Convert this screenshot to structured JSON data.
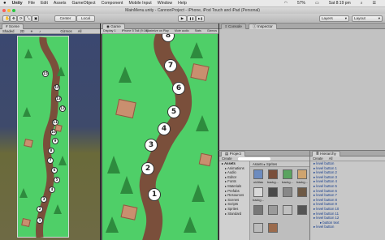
{
  "menubar": {
    "apple": "",
    "items": [
      "Unity",
      "File",
      "Edit",
      "Assets",
      "GameObject",
      "Component",
      "Mobile Input",
      "Window",
      "Help"
    ],
    "battery": "57%",
    "clock": "Sat 8:19 pm"
  },
  "window": {
    "title": "MainMenu.unity - CannonProject - iPhone, iPod Touch and iPad (Personal)"
  },
  "toolbar": {
    "tools": [
      "✋",
      "✥",
      "⟳",
      "⤡",
      "▣"
    ],
    "center": "Center",
    "local": "Local",
    "play": "▶",
    "pause": "❚❚",
    "step": "▶❚",
    "layers": "Layers",
    "layout": "Layout"
  },
  "scene": {
    "tab": "Scene",
    "shaded": "Shaded",
    "mode": "2D",
    "gizmos": "Gizmos",
    "search": "All",
    "path_numbers": [
      "15",
      "14",
      "13",
      "12",
      "11",
      "10",
      "9",
      "8",
      "7",
      "6",
      "5",
      "4",
      "3",
      "2",
      "1"
    ]
  },
  "game": {
    "tab": "Game",
    "display": "Display 1",
    "resolution": "iPhone 5 Tall (9:16)",
    "maximize": "Maximize on Play",
    "mute": "Mute audio",
    "stats": "Stats",
    "gizmos": "Gizmos",
    "path_numbers": [
      "8",
      "7",
      "6",
      "5",
      "4",
      "3",
      "2",
      "1"
    ]
  },
  "console": {
    "tab": "Console"
  },
  "inspector": {
    "tab": "Inspector"
  },
  "project": {
    "tab": "Project",
    "create": "Create",
    "breadcrumb": [
      "Assets",
      "Sprites"
    ],
    "tree": [
      "Assets",
      "Animations",
      "Audio",
      "Editor",
      "Fonts",
      "Materials",
      "Prefabs",
      "Resources",
      "Scenes",
      "Scripts",
      "Sprites",
      "Standard"
    ],
    "assets": [
      "uiAtlas",
      "backg...",
      "backg...",
      "backg...",
      "backg...",
      "",
      "",
      "",
      "",
      "",
      "",
      "",
      "",
      ""
    ]
  },
  "hierarchy": {
    "tab": "Hierarchy",
    "create": "Create",
    "search": "All",
    "items": [
      "level button",
      "level button 1",
      "level button 2",
      "level button 3",
      "level button 4",
      "level button 5",
      "level button 6",
      "level button 7",
      "level button 8",
      "level button 9",
      "level button 10",
      "level button 11",
      "level button 12",
      "button text",
      "level button"
    ]
  },
  "colors": {
    "grass": "#4fcf68",
    "path": "#7a4f3b",
    "sky": "#39466a",
    "accent": "#3875d7"
  }
}
